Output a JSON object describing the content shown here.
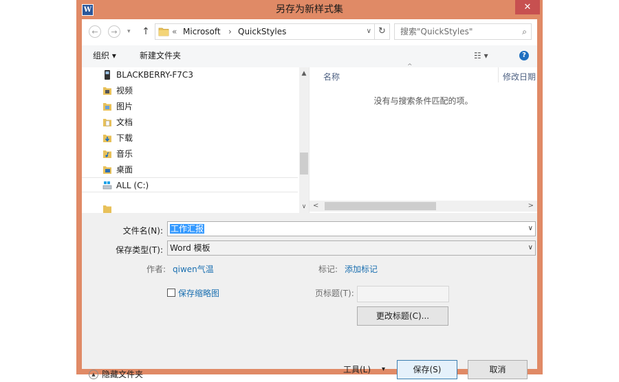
{
  "window": {
    "title": "另存为新样式集",
    "app_icon_letter": "W",
    "close_glyph": "✕"
  },
  "address_bar": {
    "back_glyph": "←",
    "forward_glyph": "→",
    "history_glyph": "▾",
    "up_glyph": "↑",
    "prefix_glyph": "«",
    "crumbs": [
      "Microsoft",
      "QuickStyles"
    ],
    "crumb_separator": "›",
    "dropdown_glyph": "∨",
    "refresh_glyph": "↻",
    "search_placeholder": "搜索\"QuickStyles\"",
    "search_glyph": "⌕"
  },
  "toolbar": {
    "organize_label": "组织 ▾",
    "new_folder_label": "新建文件夹",
    "view_glyph": "☷ ▾",
    "help_glyph": "?"
  },
  "navigation": {
    "items": [
      {
        "label": "BLACKBERRY-F7C3",
        "icon": "device-icon"
      },
      {
        "label": "视频",
        "icon": "videos-folder-icon"
      },
      {
        "label": "图片",
        "icon": "pictures-folder-icon"
      },
      {
        "label": "文档",
        "icon": "documents-folder-icon"
      },
      {
        "label": "下载",
        "icon": "downloads-folder-icon"
      },
      {
        "label": "音乐",
        "icon": "music-folder-icon"
      },
      {
        "label": "桌面",
        "icon": "desktop-folder-icon"
      },
      {
        "label": "ALL (C:)",
        "icon": "drive-icon"
      }
    ],
    "scroll_up_glyph": "▲",
    "scroll_down_glyph": "∨"
  },
  "content": {
    "columns": [
      "名称",
      "修改日期"
    ],
    "sort_glyph": "^",
    "empty_message": "没有与搜索条件匹配的项。",
    "scroll_left_glyph": "<",
    "scroll_right_glyph": ">"
  },
  "form": {
    "filename_label": "文件名(N):",
    "filename_value": "工作汇报",
    "filetype_label": "保存类型(T):",
    "filetype_value": "Word 模板",
    "author_label": "作者:",
    "author_value": "qiwen气温",
    "tags_label": "标记:",
    "tags_value": "添加标记",
    "thumbnail_label": "保存缩略图",
    "title_label": "页标题(T):",
    "change_title_label": "更改标题(C)...",
    "dropdown_glyph": "∨"
  },
  "footer": {
    "hide_folders_label": "隐藏文件夹",
    "hide_glyph": "▲",
    "tools_label": "工具(L)",
    "tools_glyph": "▾",
    "save_label": "保存(S)",
    "cancel_label": "取消"
  },
  "colors": {
    "window_frame": "#e08a66",
    "close_button": "#c75050",
    "link": "#1a6fb0",
    "selection": "#3399ff",
    "column_header": "#4d6082"
  }
}
